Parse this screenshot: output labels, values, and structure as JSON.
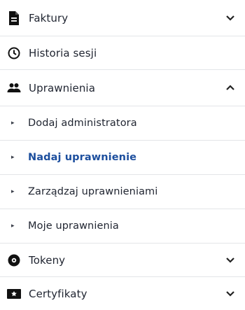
{
  "menu": {
    "faktury": {
      "label": "Faktury",
      "icon": "document-icon",
      "chevron": "chevron-down-icon"
    },
    "historia": {
      "label": "Historia sesji",
      "icon": "clock-icon"
    },
    "uprawnienia": {
      "label": "Uprawnienia",
      "icon": "users-icon",
      "chevron": "chevron-up-icon",
      "items": [
        {
          "label": "Dodaj administratora"
        },
        {
          "label": "Nadaj uprawnienie",
          "active": true
        },
        {
          "label": "Zarządzaj uprawnieniami"
        },
        {
          "label": "Moje uprawnienia"
        }
      ]
    },
    "tokeny": {
      "label": "Tokeny",
      "icon": "token-icon",
      "chevron": "chevron-down-icon"
    },
    "certyfikaty": {
      "label": "Certyfikaty",
      "icon": "certificate-icon",
      "chevron": "chevron-down-icon"
    }
  },
  "colors": {
    "active": "#1d4f9e",
    "text": "#1f2430",
    "divider": "#e3e5e8"
  }
}
